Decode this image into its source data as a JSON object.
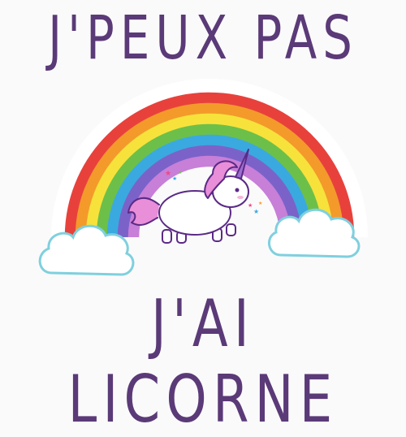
{
  "headline": {
    "top": "J'PEUX PAS",
    "bottom": "J'AI LICORNE"
  },
  "illustration": {
    "rainbow_colors": [
      "#e8413c",
      "#f39a2b",
      "#f7e23b",
      "#6cc04a",
      "#3aa9e0",
      "#7b62c9",
      "#c77fd8"
    ],
    "cloud_color": "#ffffff",
    "cloud_outline": "#6ec6d6",
    "unicorn_body": "#ffffff",
    "unicorn_mane": "#e98ed8",
    "unicorn_outline": "#5b2a86",
    "horn_color": "#9b6fd0",
    "text_color": "#5b3a78"
  }
}
